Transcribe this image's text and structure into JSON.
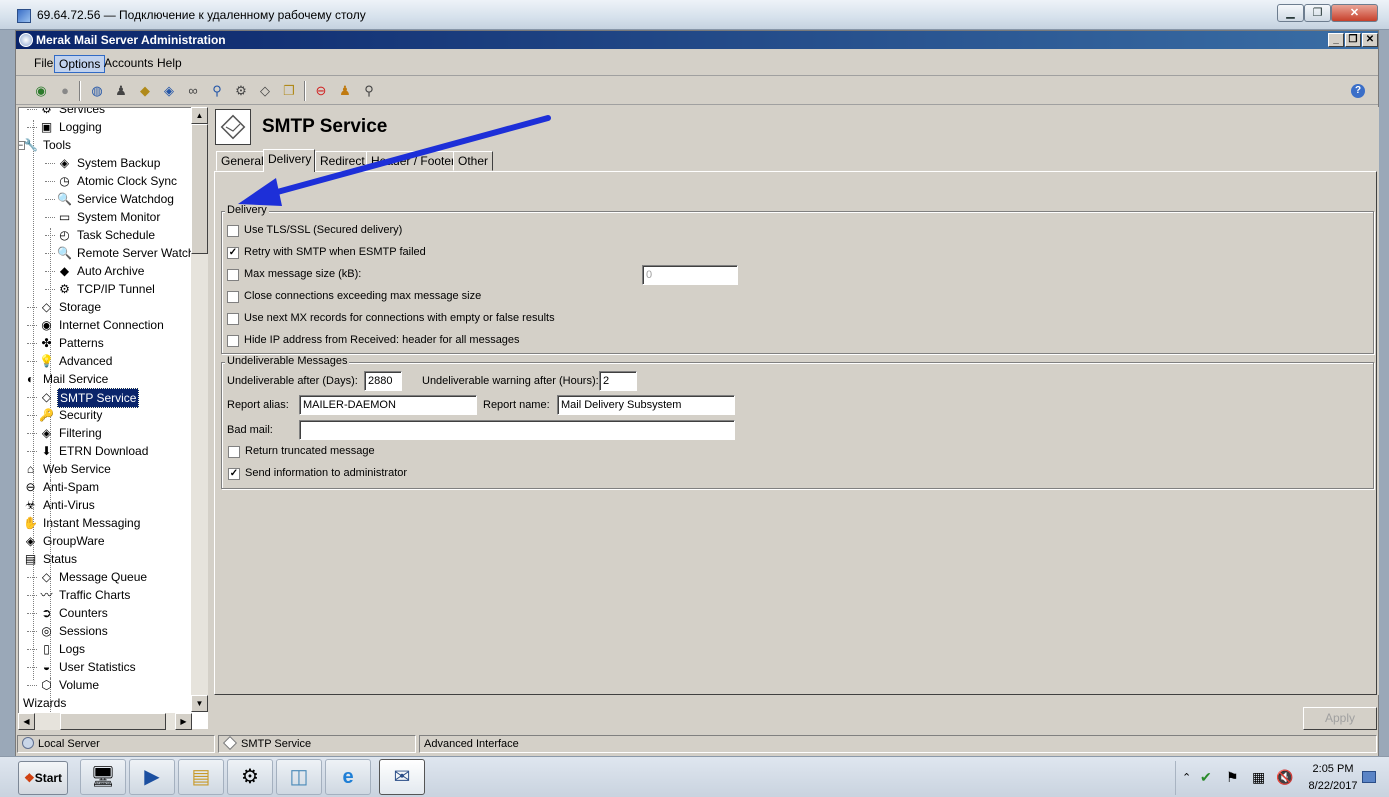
{
  "rdp": {
    "title": "69.64.72.56 — Подключение к удаленному рабочему столу",
    "min": "▁",
    "max": "❐",
    "close": "✕"
  },
  "app": {
    "title": "Merak Mail Server Administration",
    "min": "_",
    "max": "❐",
    "close": "✕"
  },
  "menu": [
    "File",
    "Options",
    "Accounts",
    "Help"
  ],
  "tree": {
    "items": [
      {
        "label": "Services",
        "level": 2,
        "icon": "gear-icon",
        "glyph": "⚙"
      },
      {
        "label": "Logging",
        "level": 2,
        "icon": "log-icon",
        "glyph": "▣"
      },
      {
        "label": "Tools",
        "level": 1,
        "icon": "tools-icon",
        "glyph": "🔧"
      },
      {
        "label": "System Backup",
        "level": 3,
        "icon": "backup-icon",
        "glyph": "◈"
      },
      {
        "label": "Atomic Clock Sync",
        "level": 3,
        "icon": "clock-icon",
        "glyph": "◷"
      },
      {
        "label": "Service Watchdog",
        "level": 3,
        "icon": "magnifier-icon",
        "glyph": "🔍"
      },
      {
        "label": "System Monitor",
        "level": 3,
        "icon": "monitor-icon",
        "glyph": "▭"
      },
      {
        "label": "Task Schedule",
        "level": 3,
        "icon": "schedule-icon",
        "glyph": "◴"
      },
      {
        "label": "Remote Server Watchdo",
        "level": 3,
        "icon": "remote-watchdog-icon",
        "glyph": "🔍"
      },
      {
        "label": "Auto Archive",
        "level": 3,
        "icon": "archive-icon",
        "glyph": "◆"
      },
      {
        "label": "TCP/IP Tunnel",
        "level": 3,
        "icon": "tunnel-icon",
        "glyph": "⚙"
      },
      {
        "label": "Storage",
        "level": 2,
        "icon": "storage-icon",
        "glyph": "◇"
      },
      {
        "label": "Internet Connection",
        "level": 2,
        "icon": "globe-icon",
        "glyph": "◉"
      },
      {
        "label": "Patterns",
        "level": 2,
        "icon": "patterns-icon",
        "glyph": "✤"
      },
      {
        "label": "Advanced",
        "level": 2,
        "icon": "lightbulb-icon",
        "glyph": "💡"
      },
      {
        "label": "Mail Service",
        "level": 1,
        "icon": "mail-service-icon",
        "glyph": "◐"
      },
      {
        "label": "SMTP Service",
        "level": 2,
        "icon": "smtp-icon",
        "glyph": "◇",
        "selected": true
      },
      {
        "label": "Security",
        "level": 2,
        "icon": "key-icon",
        "glyph": "🔑"
      },
      {
        "label": "Filtering",
        "level": 2,
        "icon": "filter-icon",
        "glyph": "◈"
      },
      {
        "label": "ETRN Download",
        "level": 2,
        "icon": "download-icon",
        "glyph": "⬇"
      },
      {
        "label": "Web Service",
        "level": 1,
        "icon": "web-service-icon",
        "glyph": "⌂"
      },
      {
        "label": "Anti-Spam",
        "level": 1,
        "icon": "antispam-icon",
        "glyph": "⊖"
      },
      {
        "label": "Anti-Virus",
        "level": 1,
        "icon": "antivirus-icon",
        "glyph": "☣"
      },
      {
        "label": "Instant Messaging",
        "level": 1,
        "icon": "im-icon",
        "glyph": "✋"
      },
      {
        "label": "GroupWare",
        "level": 1,
        "icon": "groupware-icon",
        "glyph": "◈"
      },
      {
        "label": "Status",
        "level": 1,
        "icon": "status-icon",
        "glyph": "▤"
      },
      {
        "label": "Message Queue",
        "level": 2,
        "icon": "queue-icon",
        "glyph": "◇"
      },
      {
        "label": "Traffic Charts",
        "level": 2,
        "icon": "chart-icon",
        "glyph": "〰"
      },
      {
        "label": "Counters",
        "level": 2,
        "icon": "counters-icon",
        "glyph": "➲"
      },
      {
        "label": "Sessions",
        "level": 2,
        "icon": "sessions-icon",
        "glyph": "◎"
      },
      {
        "label": "Logs",
        "level": 2,
        "icon": "logs-icon",
        "glyph": "▯"
      },
      {
        "label": "User Statistics",
        "level": 2,
        "icon": "statistics-icon",
        "glyph": "◒"
      },
      {
        "label": "Volume",
        "level": 2,
        "icon": "volume-icon",
        "glyph": "⬡"
      },
      {
        "label": "Wizards",
        "level": 0,
        "icon": "",
        "glyph": ""
      }
    ]
  },
  "page": {
    "title": "SMTP Service",
    "tabs": [
      "General",
      "Delivery",
      "Redirect",
      "Header / Footer",
      "Other"
    ],
    "active_tab": "Delivery"
  },
  "delivery": {
    "label": "Delivery",
    "options": [
      {
        "label": "Use TLS/SSL (Secured delivery)",
        "checked": false
      },
      {
        "label": "Retry with SMTP when ESMTP failed",
        "checked": true
      },
      {
        "label": "Max message size (kB):",
        "checked": false
      },
      {
        "label": "Close connections exceeding max message size",
        "checked": false
      },
      {
        "label": "Use next MX records for connections with empty or false results",
        "checked": false
      },
      {
        "label": "Hide IP address from Received: header for all messages",
        "checked": false
      }
    ],
    "max_size_value": "0"
  },
  "undeliverable": {
    "label": "Undeliverable Messages",
    "after_days_label": "Undeliverable after (Days):",
    "after_days_value": "2880",
    "warning_label": "Undeliverable warning after (Hours):",
    "warning_value": "2",
    "report_alias_label": "Report alias:",
    "report_alias_value": "MAILER-DAEMON",
    "report_name_label": "Report name:",
    "report_name_value": "Mail Delivery Subsystem",
    "bad_mail_label": "Bad mail:",
    "bad_mail_value": "",
    "return_truncated": {
      "label": "Return truncated message",
      "checked": false
    },
    "send_info": {
      "label": "Send information to administrator",
      "checked": true
    }
  },
  "apply_label": "Apply",
  "status": {
    "server": "Local Server",
    "section": "SMTP Service",
    "mode": "Advanced Interface"
  },
  "taskbar": {
    "start": "Start",
    "time": "2:05 PM",
    "date": "8/22/2017"
  },
  "colors": {
    "arrow": "#1d2fd8",
    "selection": "#0a246a",
    "titlebar": "#0a246a"
  }
}
